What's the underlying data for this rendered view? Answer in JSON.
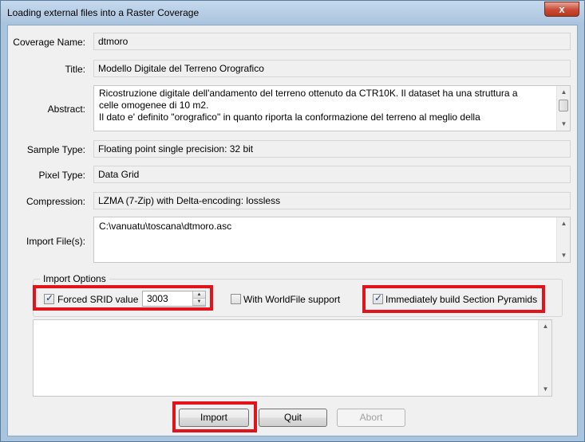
{
  "window": {
    "title": "Loading external files into a Raster Coverage",
    "close_label": "x"
  },
  "form": {
    "coverage_name": {
      "label": "Coverage Name:",
      "value": "dtmoro"
    },
    "title": {
      "label": "Title:",
      "value": "Modello Digitale del Terreno Orografico"
    },
    "abstract": {
      "label": "Abstract:",
      "lines": [
        "Ricostruzione digitale dell'andamento del terreno ottenuto da CTR10K. Il dataset ha una struttura a",
        "celle omogenee di 10 m2.",
        "Il dato e' definito \"orografico\" in quanto riporta la conformazione del terreno al meglio della"
      ]
    },
    "sample_type": {
      "label": "Sample Type:",
      "value": "Floating point single precision: 32 bit"
    },
    "pixel_type": {
      "label": "Pixel Type:",
      "value": "Data Grid"
    },
    "compression": {
      "label": "Compression:",
      "value": "LZMA (7-Zip) with Delta-encoding: lossless"
    },
    "import_files": {
      "label": "Import File(s):",
      "value": "C:\\vanuatu\\toscana\\dtmoro.asc"
    }
  },
  "import_options": {
    "legend": "Import Options",
    "forced_srid": {
      "label": "Forced SRID value",
      "checked": true,
      "value": "3003"
    },
    "worldfile": {
      "label": "With WorldFile support",
      "checked": false
    },
    "pyramids": {
      "label": "Immediately build Section Pyramids",
      "checked": true
    }
  },
  "buttons": {
    "import": "Import",
    "quit": "Quit",
    "abort": "Abort"
  },
  "colors": {
    "highlight": "#e0141a",
    "frame": "#a9c4df"
  }
}
